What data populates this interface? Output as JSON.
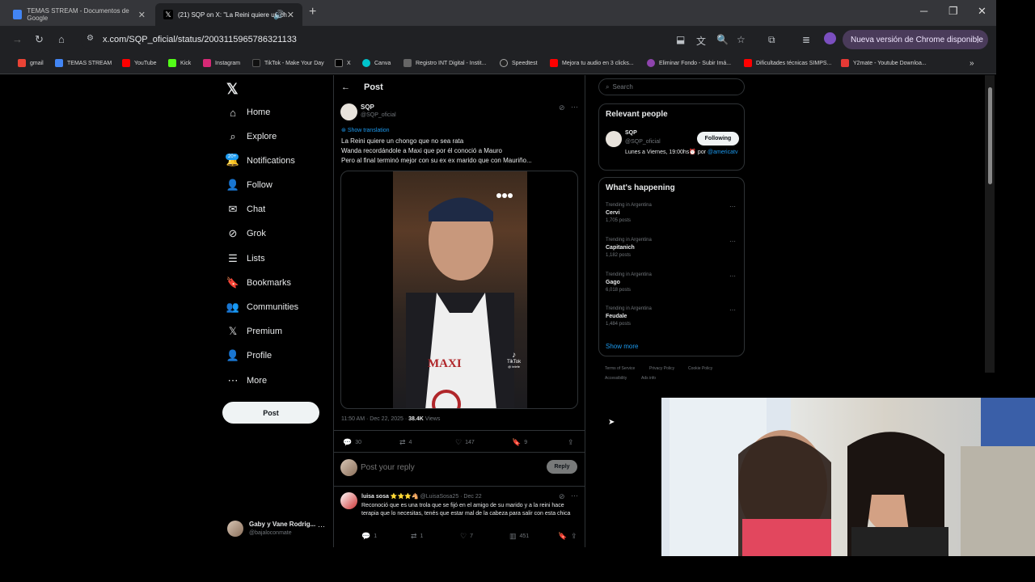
{
  "browser": {
    "tabs": [
      {
        "title": "TEMAS STREAM - Documentos de Google",
        "active": false
      },
      {
        "title": "(21) SQP on X: \"La Reini quiere un ch",
        "active": true
      }
    ],
    "url": "x.com/SQP_oficial/status/2003115965786321133",
    "update_label": "Nueva versión de Chrome disponible",
    "bookmarks": [
      "gmail",
      "TEMAS STREAM",
      "YouTube",
      "Kick",
      "Instagram",
      "TikTok - Make Your Day",
      "X",
      "Canva",
      "Registro INT Digital - Instit...",
      "Speedtest",
      "Mejora tu audio en 3 clicks...",
      "Eliminar Fondo - Subir Imá...",
      "Dificultades técnicas SIMPS...",
      "Y2mate - Youtube Downloa..."
    ]
  },
  "sidebar": {
    "items": [
      {
        "label": "Home",
        "icon": "home-icon"
      },
      {
        "label": "Explore",
        "icon": "search-icon"
      },
      {
        "label": "Notifications",
        "icon": "bell-icon"
      },
      {
        "label": "Follow",
        "icon": "follow-icon"
      },
      {
        "label": "Chat",
        "icon": "mail-icon"
      },
      {
        "label": "Grok",
        "icon": "grok-icon"
      },
      {
        "label": "Lists",
        "icon": "list-icon"
      },
      {
        "label": "Bookmarks",
        "icon": "bookmark-icon"
      },
      {
        "label": "Communities",
        "icon": "communities-icon"
      },
      {
        "label": "Premium",
        "icon": "x-icon"
      },
      {
        "label": "Profile",
        "icon": "person-icon"
      },
      {
        "label": "More",
        "icon": "more-icon"
      }
    ],
    "notif_badge": "20+",
    "post_button": "Post",
    "account": {
      "name": "Gaby y Vane Rodrig...",
      "handle": "@bajaloconmate"
    }
  },
  "post": {
    "header": "Post",
    "author_name": "SQP",
    "author_handle": "@SQP_oficial",
    "show_translation": "Show translation",
    "lines": [
      "La Reini quiere un chongo que no sea rata",
      "Wanda recordándole a Maxi que por él conoció a Mauro",
      "Pero al final terminó mejor con su ex ex marido que con Mauriño..."
    ],
    "video": {
      "apron": "MAXI",
      "watermark": "TikTok",
      "watermark_sub": "@ telefe"
    },
    "meta_time": "11:50 AM · Dec 22, 2025 · ",
    "views_count": "38.4K",
    "views_label": " Views",
    "stats": {
      "replies": "30",
      "reposts": "4",
      "likes": "147",
      "bookmarks": "9"
    },
    "reply_placeholder": "Post your reply",
    "reply_button": "Reply"
  },
  "reply": {
    "author": "luisa sosa ⭐⭐⭐🐴",
    "handle_date": "@LuisaSosa25 · Dec 22",
    "text": "Reconoció que es una trola que se fijó en el amigo de su marido y a la reini hace terapia que lo necesitas, tenés que estar mal de la cabeza para salir con esta chica",
    "stats": {
      "replies": "1",
      "reposts": "1",
      "likes": "7",
      "views": "451"
    }
  },
  "right": {
    "search_placeholder": "Search",
    "relevant_title": "Relevant people",
    "person": {
      "name": "SQP",
      "handle": "@SQP_oficial",
      "bio": "Lunes a Viernes, 19:00hs⏰ por ",
      "bio_link": "@americatv",
      "button": "Following"
    },
    "happening_title": "What's happening",
    "trends": [
      {
        "context": "Trending in Argentina",
        "name": "Cervi",
        "count": "1,705 posts"
      },
      {
        "context": "Trending in Argentina",
        "name": "Capitanich",
        "count": "1,182 posts"
      },
      {
        "context": "Trending in Argentina",
        "name": "Gago",
        "count": "6,018 posts"
      },
      {
        "context": "Trending in Argentina",
        "name": "Feudale",
        "count": "1,484 posts"
      }
    ],
    "show_more": "Show more",
    "footer": [
      "Terms of Service",
      "Privacy Policy",
      "Cookie Policy",
      "Accessibility",
      "Ads info"
    ]
  }
}
